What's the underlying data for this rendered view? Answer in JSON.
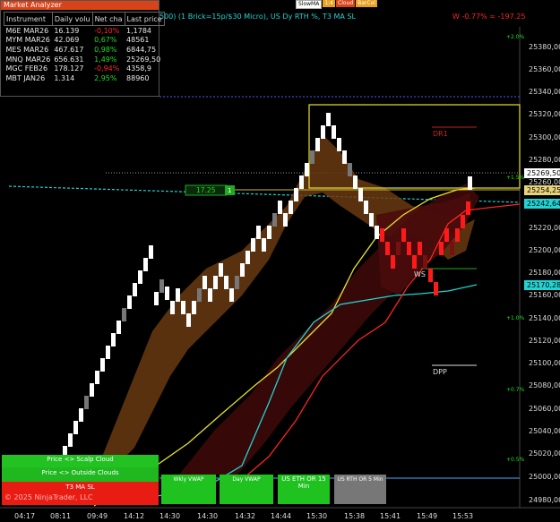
{
  "market_analyzer": {
    "title": "Market Analyzer",
    "columns": [
      "Instrument",
      "Daily volu",
      "Net cha",
      "Last price"
    ],
    "rows": [
      {
        "instrument": "M6E MAR26",
        "volume": "16.139",
        "net": "-0,10%",
        "net_dir": "neg",
        "last": "1,1784"
      },
      {
        "instrument": "MYM MAR26",
        "volume": "42.069",
        "net": "0,67%",
        "net_dir": "pos",
        "last": "48561"
      },
      {
        "instrument": "MES MAR26",
        "volume": "467.617",
        "net": "0,98%",
        "net_dir": "pos",
        "last": "6844,75"
      },
      {
        "instrument": "MNQ MAR26",
        "volume": "656.631",
        "net": "1,49%",
        "net_dir": "pos",
        "last": "25269,50"
      },
      {
        "instrument": "MGC FEB26",
        "volume": "178.127",
        "net": "-0,94%",
        "net_dir": "neg",
        "last": "4358,9"
      },
      {
        "instrument": "MBT JAN26",
        "volume": "1.314",
        "net": "2,95%",
        "net_dir": "pos",
        "last": "88960"
      }
    ]
  },
  "toolbar": {
    "slowma": "SlowMA",
    "x": "1:4",
    "cloud": "Cloud",
    "barcol": "BarCol"
  },
  "status": {
    "chart_desc": "500) (1 Brick=15p/$30 Micro), US Dy RTH %, T3 MA SL",
    "pl": "W -0.77% = -197.25"
  },
  "labels": {
    "dr1": "DR1",
    "ws": "WS",
    "dpp": "DPP",
    "box_value": "17.25",
    "box_qty": "1"
  },
  "price_axis": {
    "ticks": [
      "25380,00",
      "25360,00",
      "25340,00",
      "25320,00",
      "25300,00",
      "25280,00",
      "25260,00",
      "25220,00",
      "25200,00",
      "25180,00",
      "25160,00",
      "25140,00",
      "25120,00",
      "25100,00",
      "25080,00",
      "25060,00",
      "25040,00",
      "25020,00",
      "25000,00",
      "24980,00"
    ],
    "pct_ticks": [
      "+2.0%",
      "+1.5%",
      "+1.0%",
      "+0.7%",
      "+0.5%"
    ],
    "badges": {
      "last": "25269,50",
      "yellow": "25254,25",
      "cyan1": "25242,64",
      "cyan2": "25170,28"
    }
  },
  "time_axis": [
    "04:17",
    "08:11",
    "09:49",
    "14:12",
    "14:30",
    "14:30",
    "14:32",
    "14:44",
    "15:30",
    "15:38",
    "15:41",
    "15:49",
    "15:53"
  ],
  "bottom_panel": {
    "scalp": "Price <> Scalp Cloud",
    "outside": "Price <> Outside Clouds",
    "t3": "T3 MA SL",
    "copyright": "© 2025 NinjaTrader, LLC"
  },
  "vwap_buttons": [
    "Wkly VWAP",
    "Day VWAP",
    "US ETH OR 15 Min",
    "US RTH OR 5 Min"
  ],
  "colors": {
    "accent_orange": "#d9431a",
    "cyan": "#22d3d3",
    "yellow": "#e8e22a",
    "green": "#22dd22",
    "red": "#ff2222"
  }
}
